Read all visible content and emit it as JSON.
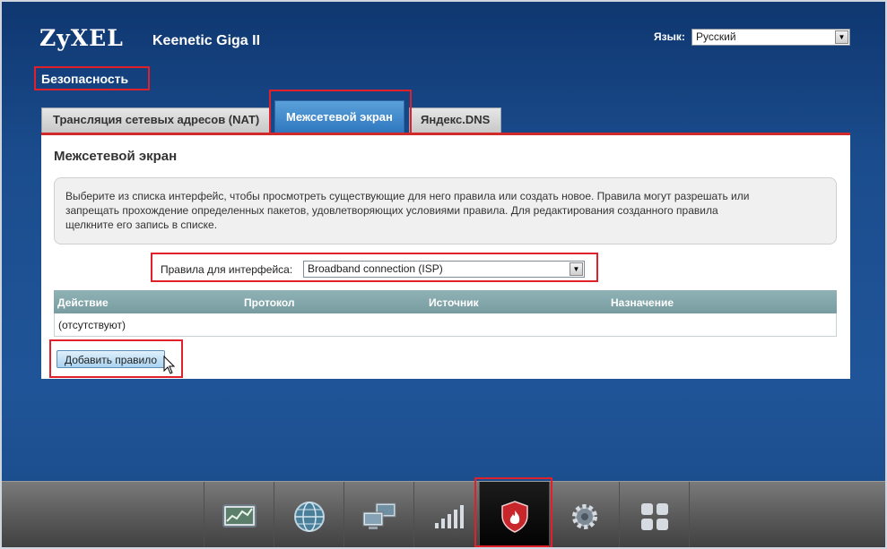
{
  "header": {
    "logo": "ZyXEL",
    "model": "Keenetic Giga II",
    "language_label": "Язык:",
    "language_value": "Русский"
  },
  "section_title": "Безопасность",
  "tabs": [
    {
      "label": "Трансляция сетевых адресов (NAT)",
      "active": false
    },
    {
      "label": "Межсетевой экран",
      "active": true
    },
    {
      "label": "Яндекс.DNS",
      "active": false
    }
  ],
  "panel": {
    "title": "Межсетевой экран",
    "info": "Выберите из списка интерфейс, чтобы просмотреть существующие для него правила или создать новое. Правила могут разрешать или запрещать прохождение определенных пакетов, удовлетворяющих условиями правила. Для редактирования созданного правила щелкните его запись в списке.",
    "info_lines": [
      "Выберите из списка интерфейс, чтобы просмотреть существующие для него правила или создать новое. Правила могут разрешать или",
      "запрещать прохождение определенных пакетов, удовлетворяющих условиями правила. Для редактирования созданного правила",
      "щелкните его запись в списке."
    ],
    "interface_label": "Правила для интерфейса:",
    "interface_value": "Broadband connection (ISP)",
    "table": {
      "columns": [
        "Действие",
        "Протокол",
        "Источник",
        "Назначение"
      ],
      "empty_text": "(отсутствуют)"
    },
    "add_button": "Добавить правило"
  },
  "taskbar": [
    {
      "icon": "monitor-chart-icon",
      "active": false
    },
    {
      "icon": "globe-icon",
      "active": false
    },
    {
      "icon": "network-computers-icon",
      "active": false
    },
    {
      "icon": "signal-bars-icon",
      "active": false
    },
    {
      "icon": "security-shield-icon",
      "active": true
    },
    {
      "icon": "gear-icon",
      "active": false
    },
    {
      "icon": "apps-grid-icon",
      "active": false
    }
  ],
  "colors": {
    "highlight": "#e0202a",
    "active_tab": "#3a84c9",
    "table_header": "#83a8ab"
  }
}
